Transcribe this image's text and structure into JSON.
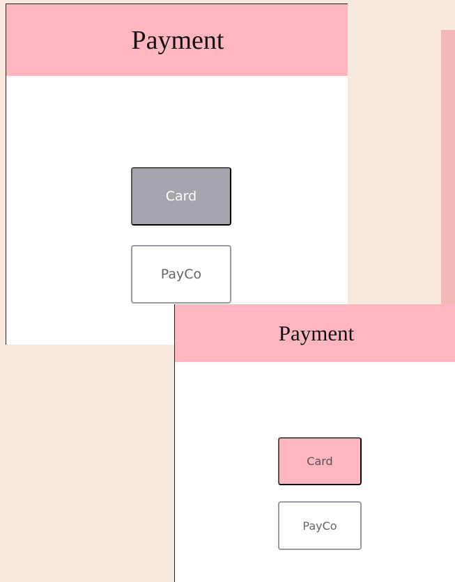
{
  "colors": {
    "background": "#f7e9de",
    "header": "#ffb6c1",
    "card_selected": "#a6a4ad",
    "card_default": "#ffb6c1",
    "outline": "#9a99a2",
    "side_strip": "#f4b8b8"
  },
  "screens": [
    {
      "title": "Payment",
      "buttons": {
        "card": {
          "label": "Card"
        },
        "payco": {
          "label": "PayCo"
        }
      }
    },
    {
      "title": "Payment",
      "buttons": {
        "card": {
          "label": "Card"
        },
        "payco": {
          "label": "PayCo"
        }
      }
    }
  ]
}
